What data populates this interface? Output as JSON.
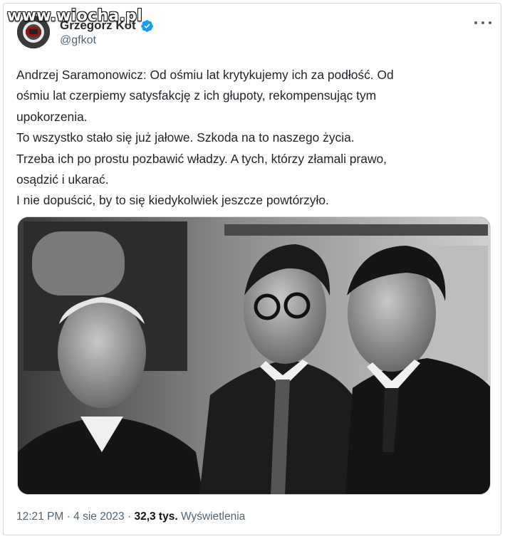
{
  "watermark": "www.wiocha.pl",
  "author": {
    "display_name": "Grzegorz Kot",
    "handle": "@gfkot",
    "verified": true
  },
  "tweet": {
    "lines": [
      "Andrzej Saramonowicz: Od ośmiu lat krytykujemy ich za podłość. Od",
      "ośmiu lat czerpiemy satysfakcję z ich głupoty, rekompensując tym",
      "upokorzenia.",
      "To wszystko stało się już jałowe. Szkoda na to naszego życia.",
      "Trzeba ich po prostu pozbawić władzy. A tych, którzy złamali prawo,",
      "osądzić i ukarać.",
      "I nie dopuścić, by to się kiedykolwiek jeszcze powtórzyło."
    ]
  },
  "meta": {
    "time": "12:21 PM",
    "sep1": " · ",
    "date": "4 sie 2023",
    "sep2": " · ",
    "view_count": "32,3 tys.",
    "views_label": " Wyświetlenia"
  },
  "icons": {
    "verified": "verified-badge-icon",
    "more": "more-options-icon"
  },
  "colors": {
    "verified_blue": "#1d9bf0",
    "secondary_text": "#536471"
  }
}
